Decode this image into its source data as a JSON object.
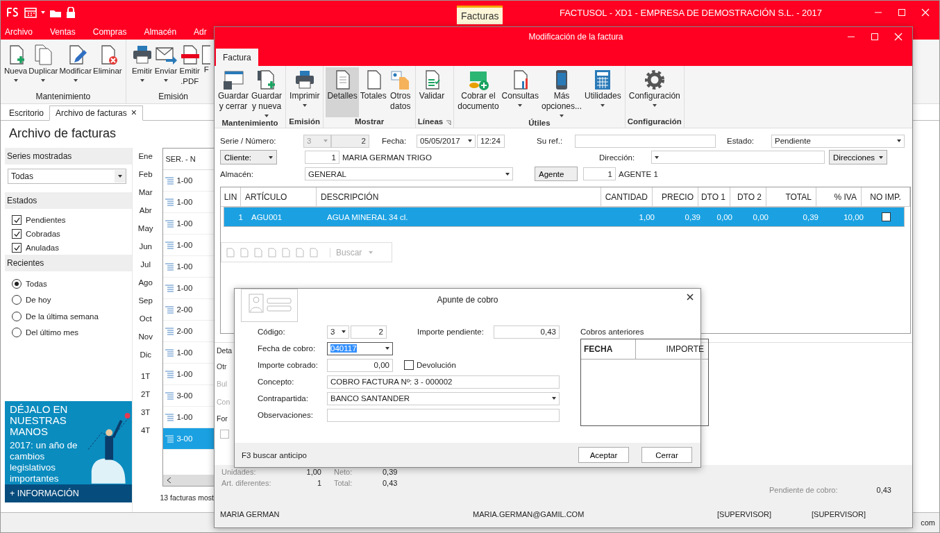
{
  "title_bar": {
    "context_tab": "Facturas",
    "title": "FACTUSOL - XD1 - EMPRESA DE DEMOSTRACIÓN S.L. - 2017"
  },
  "menu": [
    "Archivo",
    "Ventas",
    "Compras",
    "Almacén",
    "Adr"
  ],
  "ribbon": {
    "groups": [
      {
        "label": "Mantenimiento",
        "buttons": [
          {
            "label": "Nueva",
            "has_menu": true
          },
          {
            "label": "Duplicar",
            "has_menu": true
          },
          {
            "label": "Modificar",
            "has_menu": true
          },
          {
            "label": "Eliminar",
            "has_menu": false
          }
        ]
      },
      {
        "label": "Emisión",
        "buttons": [
          {
            "label": "Emitir",
            "has_menu": true
          },
          {
            "label": "Enviar",
            "has_menu": true
          },
          {
            "label": "Emitir\n.PDF",
            "has_menu": false
          },
          {
            "label": "F",
            "has_menu": false
          }
        ]
      }
    ]
  },
  "doc_tabs": [
    {
      "label": "Escritorio",
      "selected": false
    },
    {
      "label": "Archivo de facturas",
      "selected": true,
      "close": "×"
    }
  ],
  "page_title": "Archivo de facturas",
  "filters": {
    "series": {
      "heading": "Series mostradas",
      "value": "Todas"
    },
    "estados": {
      "heading": "Estados",
      "items": [
        {
          "label": "Pendientes",
          "checked": true
        },
        {
          "label": "Cobradas",
          "checked": true
        },
        {
          "label": "Anuladas",
          "checked": true
        }
      ]
    },
    "recientes": {
      "heading": "Recientes",
      "items": [
        {
          "label": "Todas",
          "selected": true
        },
        {
          "label": "De hoy",
          "selected": false
        },
        {
          "label": "De la última semana",
          "selected": false
        },
        {
          "label": "Del último mes",
          "selected": false
        }
      ]
    }
  },
  "ad": {
    "headline": "DÉJALO EN NUESTRAS MANOS",
    "body": "2017: un año de cambios legislativos importantes",
    "link": "+ INFORMACIÓN"
  },
  "periods": [
    "Ene",
    "Feb",
    "Mar",
    "Abr",
    "May",
    "Jun",
    "Jul",
    "Ago",
    "Sep",
    "Oct",
    "Nov",
    "Dic",
    "1T",
    "2T",
    "3T",
    "4T"
  ],
  "invoice_list": {
    "column_1": "SER. - N",
    "rows": [
      {
        "text": "1-00",
        "selected": false
      },
      {
        "text": "1-00",
        "selected": false
      },
      {
        "text": "1-00",
        "selected": false
      },
      {
        "text": "1-00",
        "selected": false
      },
      {
        "text": "1-00",
        "selected": false
      },
      {
        "text": "1-00",
        "selected": false
      },
      {
        "text": "2-00",
        "selected": false
      },
      {
        "text": "2-00",
        "selected": false
      },
      {
        "text": "1-00",
        "selected": false
      },
      {
        "text": "1-00",
        "selected": false
      },
      {
        "text": "3-00",
        "selected": false
      },
      {
        "text": "1-00",
        "selected": false
      },
      {
        "text": "3-00",
        "selected": true
      }
    ]
  },
  "list_count": "13 facturas most",
  "status_corner": "com",
  "invoice_window": {
    "title": "Modificación de la factura",
    "tab": "Factura",
    "ribbon": {
      "groups": [
        {
          "label": "Mantenimiento",
          "launcher": false,
          "buttons": [
            {
              "label": "Guardar\ny cerrar",
              "has_menu": false,
              "selected": false
            },
            {
              "label": "Guardar\ny nueva",
              "has_menu": true,
              "selected": false
            }
          ]
        },
        {
          "label": "Emisión",
          "launcher": false,
          "buttons": [
            {
              "label": "Imprimir",
              "has_menu": true,
              "selected": false
            }
          ]
        },
        {
          "label": "Mostrar",
          "launcher": false,
          "buttons": [
            {
              "label": "Detalles",
              "has_menu": false,
              "selected": true
            },
            {
              "label": "Totales",
              "has_menu": false,
              "selected": false
            },
            {
              "label": "Otros\ndatos",
              "has_menu": false,
              "selected": false
            }
          ]
        },
        {
          "label": "Líneas",
          "launcher": true,
          "buttons": [
            {
              "label": "Validar",
              "has_menu": false,
              "selected": false
            }
          ]
        },
        {
          "label": "Útiles",
          "launcher": false,
          "buttons": [
            {
              "label": "Cobrar el\ndocumento",
              "has_menu": false,
              "selected": false
            },
            {
              "label": "Consultas",
              "has_menu": true,
              "selected": false
            },
            {
              "label": "Más\nopciones...",
              "has_menu": true,
              "selected": false
            },
            {
              "label": "Utilidades",
              "has_menu": true,
              "selected": false
            }
          ]
        },
        {
          "label": "Configuración",
          "launcher": false,
          "buttons": [
            {
              "label": "Configuración",
              "has_menu": true,
              "selected": false
            }
          ]
        }
      ]
    },
    "form": {
      "serie_label": "Serie / Número:",
      "serie": "3",
      "numero": "2",
      "fecha_label": "Fecha:",
      "fecha": "05/05/2017",
      "hora": "12:24",
      "su_ref_label": "Su ref.:",
      "estado_label": "Estado:",
      "estado": "Pendiente",
      "cliente_button": "Cliente:",
      "cliente_code": "1",
      "cliente_name": "MARIA GERMAN TRIGO",
      "direccion_label": "Dirección:",
      "direcciones_button": "Direcciones",
      "almacen_label": "Almacén:",
      "almacen": "GENERAL",
      "agente_button": "Agente",
      "agente_code": "1",
      "agente_name": "AGENTE 1"
    },
    "lines_table": {
      "columns": [
        "LIN",
        "ARTÍCULO",
        "DESCRIPCIÓN",
        "CANTIDAD",
        "PRECIO",
        "DTO 1",
        "DTO 2",
        "TOTAL",
        "% IVA",
        "NO IMP."
      ],
      "rows": [
        {
          "cells": [
            "1",
            "AGU001",
            "AGUA MINERAL 34 cl.",
            "1,00",
            "0,39",
            "0,00",
            "0,00",
            "0,39",
            "10,00"
          ],
          "no_imp": false,
          "selected": true
        }
      ]
    },
    "line_toolbar": {
      "search": "Buscar"
    },
    "details": [
      "Deta",
      "Otr",
      "Bul",
      "Con",
      "For"
    ],
    "details_checkbox_checked": false,
    "totals": [
      {
        "label": "Unidades:",
        "value": "1,00"
      },
      {
        "label": "Art. diferentes:",
        "value": "1"
      },
      {
        "label": "Neto:",
        "value": "0,39"
      },
      {
        "label": "Total:",
        "value": "0,43"
      },
      {
        "label": "Pendiente de cobro:",
        "value": "0,43"
      }
    ],
    "status_bar": [
      "MARIA GERMAN",
      "MARIA.GERMAN@GAMIL.COM",
      "[SUPERVISOR]",
      "[SUPERVISOR]"
    ]
  },
  "payment_dialog": {
    "title": "Apunte de cobro",
    "codigo_label": "Código:",
    "codigo_serie": "3",
    "codigo_numero": "2",
    "pendiente_label": "Importe pendiente:",
    "pendiente": "0,43",
    "fecha_label": "Fecha de cobro:",
    "fecha": "040117",
    "fecha_selected": true,
    "cobrado_label": "Importe cobrado:",
    "cobrado": "0,00",
    "devolucion_label": "Devolución",
    "devolucion": false,
    "concepto_label": "Concepto:",
    "concepto": "COBRO FACTURA Nº: 3 - 000002",
    "contrapartida_label": "Contrapartida:",
    "contrapartida": "BANCO SANTANDER",
    "observaciones_label": "Observaciones:",
    "previous": {
      "heading": "Cobros anteriores",
      "columns": [
        "FECHA",
        "IMPORTE"
      ]
    },
    "hint": "F3 buscar anticipo",
    "buttons": [
      "Aceptar",
      "Cerrar"
    ]
  }
}
